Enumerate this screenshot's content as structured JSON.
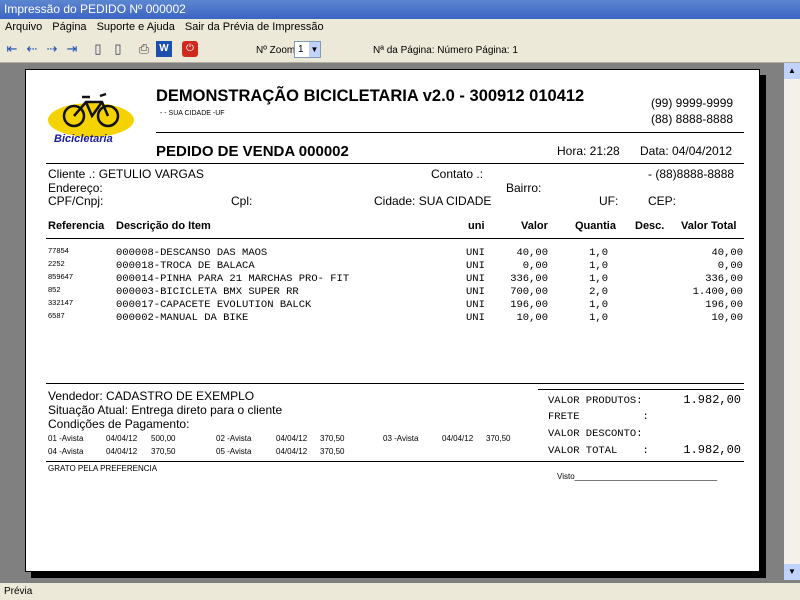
{
  "window": {
    "title": "Impressão do PEDIDO Nº 000002"
  },
  "menu": [
    "Arquivo",
    "Página",
    "Suporte e Ajuda",
    "Sair da Prévia de Impressão"
  ],
  "toolbar": {
    "zoom_label": "Nº Zoom",
    "zoom_value": "1",
    "page_label": "Nª da Página: Número Página: 1"
  },
  "report": {
    "logo_text": "Bicicletaria",
    "company": "DEMONSTRAÇÃO BICICLETARIA v2.0 - 300912 010412",
    "city": "-  - SUA CIDADE -UF",
    "phone1": "(99) 9999-9999",
    "phone2": "(88) 8888-8888",
    "order_title": "PEDIDO DE VENDA 000002",
    "hora": "Hora: 21:28",
    "data": "Data: 04/04/2012",
    "cliente": "Cliente    .: GETULIO VARGAS",
    "contato": "Contato .:",
    "cliente_fone": "- (88)8888-8888",
    "endereco": "Endereço:",
    "bairro": "Bairro:",
    "cpf": "CPF/Cnpj:",
    "cpl": "Cpl:",
    "cidade": "Cidade: SUA CIDADE",
    "uf": "UF:",
    "cep": "CEP:",
    "columns": [
      "Referencia",
      "Descrição do Item",
      "uni",
      "Valor",
      "Quantia",
      "Desc.",
      "Valor Total"
    ],
    "items": [
      {
        "ref": "77854",
        "desc": "000008-DESCANSO DAS MAOS",
        "uni": "UNI",
        "valor": "40,00",
        "qtd": "1,0",
        "total": "40,00"
      },
      {
        "ref": "2252",
        "desc": "000018-TROCA DE BALACA",
        "uni": "UNI",
        "valor": "0,00",
        "qtd": "1,0",
        "total": "0,00"
      },
      {
        "ref": "859647",
        "desc": "000014-PINHA PARA 21 MARCHAS PRO- FIT",
        "uni": "UNI",
        "valor": "336,00",
        "qtd": "1,0",
        "total": "336,00"
      },
      {
        "ref": "852",
        "desc": "000003-BICICLETA  BMX SUPER RR",
        "uni": "UNI",
        "valor": "700,00",
        "qtd": "2,0",
        "total": "1.400,00"
      },
      {
        "ref": "332147",
        "desc": "000017-CAPACETE EVOLUTION BALCK",
        "uni": "UNI",
        "valor": "196,00",
        "qtd": "1,0",
        "total": "196,00"
      },
      {
        "ref": "6587",
        "desc": "000002-MANUAL DA BIKE",
        "uni": "UNI",
        "valor": "10,00",
        "qtd": "1,0",
        "total": "10,00"
      }
    ],
    "vendedor": "Vendedor: CADASTRO DE EXEMPLO",
    "situacao": "Situação Atual: Entrega direto para o cliente",
    "condicoes": "Condições de Pagamento:",
    "payments": [
      {
        "label": "01 -Avista",
        "date": "04/04/12",
        "value": "500,00"
      },
      {
        "label": "02 -Avista",
        "date": "04/04/12",
        "value": "370,50"
      },
      {
        "label": "03 -Avista",
        "date": "04/04/12",
        "value": "370,50"
      },
      {
        "label": "04 -Avista",
        "date": "04/04/12",
        "value": "370,50"
      },
      {
        "label": "05 -Avista",
        "date": "04/04/12",
        "value": "370,50"
      }
    ],
    "totals": {
      "produtos_label": "VALOR PRODUTOS:",
      "produtos_value": "1.982,00",
      "frete_label": "FRETE          :",
      "desconto_label": "VALOR DESCONTO:",
      "total_label": "VALOR TOTAL    :",
      "total_value": "1.982,00"
    },
    "footer": "GRATO PELA PREFERENCIA",
    "visto": "Visto________________________________"
  },
  "status": "Prévia"
}
